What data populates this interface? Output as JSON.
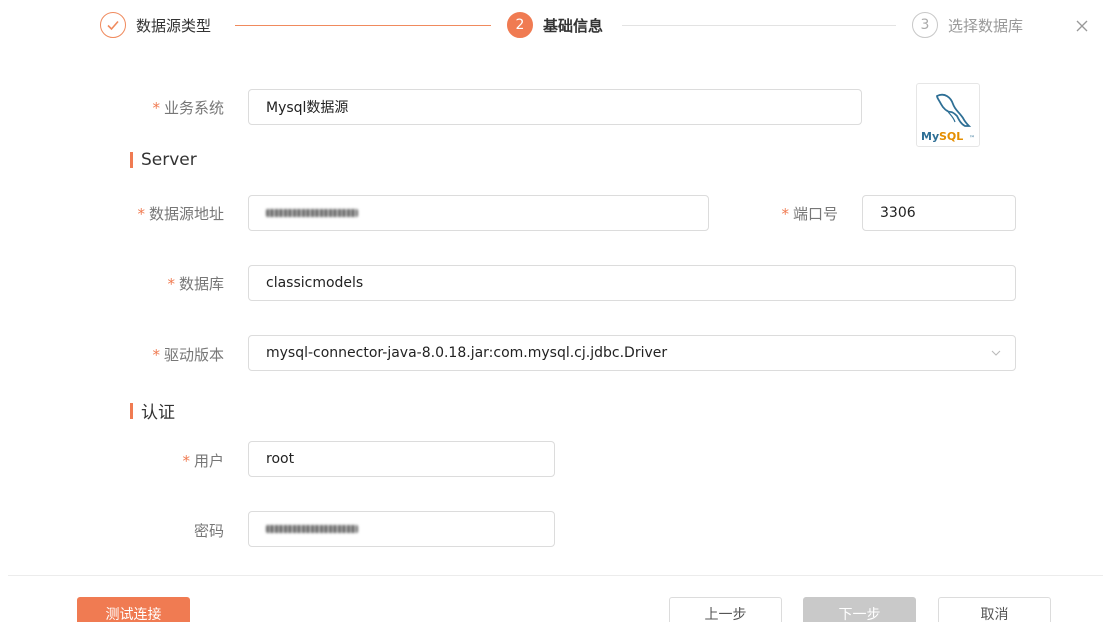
{
  "steps": [
    {
      "label": "数据源类型",
      "status": "done",
      "icon": "check-icon"
    },
    {
      "label": "基础信息",
      "number": "2",
      "status": "active"
    },
    {
      "label": "选择数据库",
      "number": "3",
      "status": "pending"
    }
  ],
  "close_icon": "close-icon",
  "required_mark": "*",
  "form": {
    "business_system": {
      "label": "业务系统",
      "value": "Mysql数据源"
    },
    "logo": {
      "icon": "mysql-logo-icon",
      "text": "MySQL"
    },
    "section_server": "Server",
    "host": {
      "label": "数据源地址"
    },
    "port": {
      "label": "端口号",
      "value": "3306"
    },
    "database": {
      "label": "数据库",
      "value": "classicmodels"
    },
    "driver": {
      "label": "驱动版本",
      "value": "mysql-connector-java-8.0.18.jar:com.mysql.cj.jdbc.Driver",
      "icon": "chevron-down-icon"
    },
    "section_auth": "认证",
    "user": {
      "label": "用户",
      "value": "root"
    },
    "password": {
      "label": "密码"
    }
  },
  "buttons": {
    "test": "测试连接",
    "prev": "上一步",
    "next": "下一步",
    "cancel": "取消"
  },
  "colors": {
    "accent": "#f07b52",
    "disabled": "#c9c9c9",
    "border": "#dcdcdc"
  }
}
